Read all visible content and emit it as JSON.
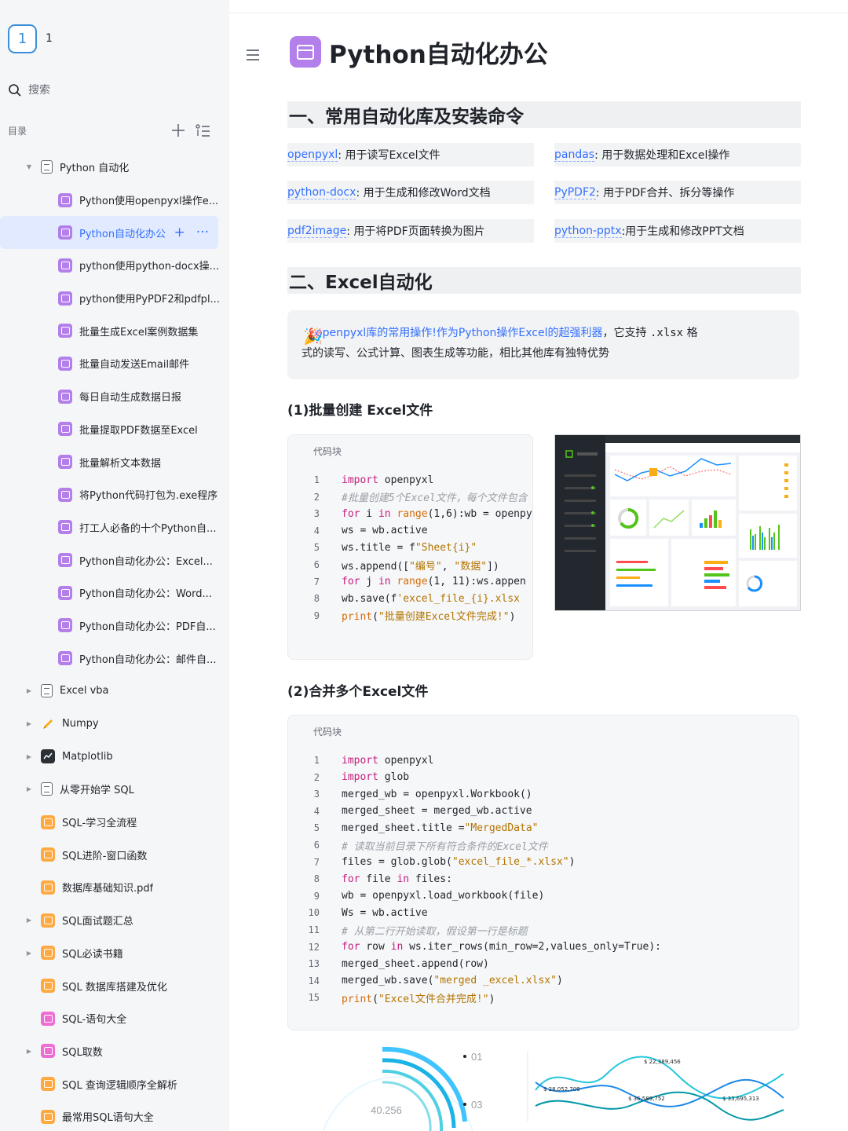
{
  "workspace": {
    "badge": "1",
    "name": "1"
  },
  "search": {
    "placeholder": "搜索"
  },
  "toc": {
    "title": "目录"
  },
  "tree": [
    {
      "label": "Python 自动化",
      "icon": "doc",
      "indent": 0,
      "arrow": "down"
    },
    {
      "label": "Python使用openpyxl操作e...",
      "icon": "purple",
      "indent": 1
    },
    {
      "label": "Python自动化办公",
      "icon": "purple",
      "indent": 1,
      "active": true
    },
    {
      "label": "python使用python-docx操...",
      "icon": "purple",
      "indent": 1
    },
    {
      "label": "python使用PyPDF2和pdfpl...",
      "icon": "purple",
      "indent": 1
    },
    {
      "label": "批量生成Excel案例数据集",
      "icon": "purple",
      "indent": 1
    },
    {
      "label": "批量自动发送Email邮件",
      "icon": "purple",
      "indent": 1
    },
    {
      "label": "每日自动生成数据日报",
      "icon": "purple",
      "indent": 1
    },
    {
      "label": "批量提取PDF数据至Excel",
      "icon": "purple",
      "indent": 1
    },
    {
      "label": "批量解析文本数据",
      "icon": "purple",
      "indent": 1
    },
    {
      "label": "将Python代码打包为.exe程序",
      "icon": "purple",
      "indent": 1
    },
    {
      "label": "打工人必备的十个Python自...",
      "icon": "purple",
      "indent": 1
    },
    {
      "label": "Python自动化办公：Excel...",
      "icon": "purple",
      "indent": 1
    },
    {
      "label": "Python自动化办公：Word...",
      "icon": "purple",
      "indent": 1
    },
    {
      "label": "Python自动化办公：PDF自...",
      "icon": "purple",
      "indent": 1
    },
    {
      "label": "Python自动化办公：邮件自...",
      "icon": "purple",
      "indent": 1
    },
    {
      "label": "Excel vba",
      "icon": "doc",
      "indent": 0,
      "arrow": "right"
    },
    {
      "label": "Numpy",
      "icon": "yellow",
      "indent": 0,
      "arrow": "right"
    },
    {
      "label": "Matplotlib",
      "icon": "dark",
      "indent": 0,
      "arrow": "right"
    },
    {
      "label": "从零开始学 SQL",
      "icon": "doc",
      "indent": 0,
      "arrow": "right"
    },
    {
      "label": "SQL-学习全流程",
      "icon": "orange",
      "indent": 0
    },
    {
      "label": "SQL进阶-窗口函数",
      "icon": "orange",
      "indent": 0
    },
    {
      "label": "数据库基础知识.pdf",
      "icon": "orange",
      "indent": 0
    },
    {
      "label": "SQL面试题汇总",
      "icon": "orange",
      "indent": 0,
      "arrow": "right"
    },
    {
      "label": "SQL必读书籍",
      "icon": "orange",
      "indent": 0,
      "arrow": "right"
    },
    {
      "label": "SQL 数据库搭建及优化",
      "icon": "orange",
      "indent": 0
    },
    {
      "label": "SQL-语句大全",
      "icon": "pink",
      "indent": 0
    },
    {
      "label": "SQL取数",
      "icon": "pink",
      "indent": 0,
      "arrow": "right"
    },
    {
      "label": "SQL 查询逻辑顺序全解析",
      "icon": "orange",
      "indent": 0
    },
    {
      "label": "最常用SQL语句大全",
      "icon": "orange",
      "indent": 0
    }
  ],
  "page": {
    "title": "Python自动化办公"
  },
  "section1": {
    "title": "一、常用自动化库及安装命令"
  },
  "libs": [
    {
      "name": "openpyxl",
      "desc": ": 用于读写Excel文件"
    },
    {
      "name": "pandas",
      "desc": ": 用于数据处理和Excel操作"
    },
    {
      "name": "python-docx",
      "desc": ": 用于生成和修改Word文档"
    },
    {
      "name": "PyPDF2",
      "desc": ": 用于PDF合并、拆分等操作"
    },
    {
      "name": "pdf2image",
      "desc": ": 用于将PDF页面转换为图片"
    },
    {
      "name": "python-pptx",
      "desc": ":用于生成和修改PPT文档"
    }
  ],
  "section2": {
    "title": "二、Excel自动化"
  },
  "callout": {
    "highlight": "openpyxl库的常用操作!作为Python操作Excel的超强利器",
    "mid": "，它支持 ",
    "code": ".xlsx",
    "end": " 格",
    "line2": "式的读写、公式计算、图表生成等功能，相比其他库有独特优势"
  },
  "sub1": {
    "title": "(1)批量创建 Excel文件"
  },
  "sub2": {
    "title": "(2)合并多个Excel文件"
  },
  "codeblock_label": "代码块",
  "code1": [
    "import openpyxl",
    "#批量创建5个Excel文件，每个文件包含",
    "for i in range(1,6):wb = openpy",
    "ws = wb.active",
    "ws.title = f\"Sheet{i}\"",
    "ws.append([\"编号\", \"数据\"])",
    "for j in range(1, 11):ws.appen",
    "wb.save(f'excel_file_{i}.xlsx",
    "print(\"批量创建Excel文件完成!\")"
  ],
  "code2": [
    "import openpyxl",
    "import glob",
    "merged_wb = openpyxl.Workbook()",
    "merged_sheet = merged_wb.active",
    "merged_sheet.title =\"MergedData\"",
    "# 读取当前目录下所有符合条件的Excel文件",
    "files = glob.glob(\"excel_file_*.xlsx\")",
    "for file in files:",
    "wb = openpyxl.load_workbook(file)",
    "Ws = wb.active",
    "# 从第二行开始读取，假设第一行是标题",
    "for row in ws.iter_rows(min_row=2,values_only=True):",
    "merged_sheet.append(row)",
    "merged_wb.save(\"merged _excel.xlsx\")",
    "print(\"Excel文件合并完成!\")"
  ],
  "bottom_chart": {
    "center_value": "40.256",
    "steps": [
      "01",
      "03"
    ],
    "labels": [
      "$ 22,389,456",
      "$ 28,052,709",
      "$ 36,589,752",
      "$ 33,695,313"
    ]
  },
  "colors": {
    "accent": "#3370ff",
    "page_icon": "#b37feb"
  }
}
